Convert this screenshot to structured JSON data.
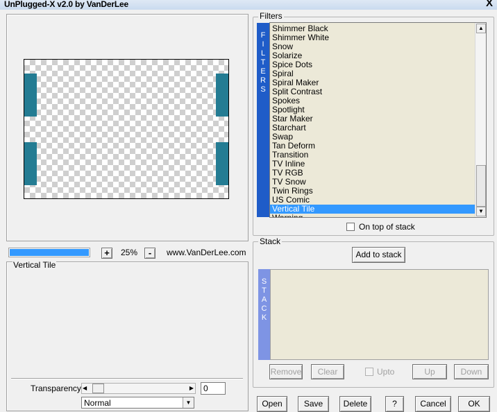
{
  "window": {
    "title": "UnPlugged-X v2.0 by VanDerLee",
    "close_glyph": "X"
  },
  "preview": {
    "zoom_minus": "-",
    "zoom_plus": "+",
    "zoom_level": "25%",
    "website": "www.VanDerLee.com",
    "progress_fraction": 1.0
  },
  "parameters": {
    "group_label": "Vertical Tile",
    "transparency_label": "Transparency",
    "transparency_value": "0",
    "blend_mode": "Normal"
  },
  "filters": {
    "group_label": "Filters",
    "side_label_letters": [
      "F",
      "I",
      "L",
      "T",
      "E",
      "R",
      "S"
    ],
    "items": [
      "Shimmer Black",
      "Shimmer White",
      "Snow",
      "Solarize",
      "Spice Dots",
      "Spiral",
      "Spiral Maker",
      "Split Contrast",
      "Spokes",
      "Spotlight",
      "Star Maker",
      "Starchart",
      "Swap",
      "Tan Deform",
      "Transition",
      "TV Inline",
      "TV RGB",
      "TV Snow",
      "Twin Rings",
      "US Comic",
      "Vertical Tile",
      "Warning"
    ],
    "selected": "Vertical Tile",
    "on_top_label": "On top of stack"
  },
  "stack": {
    "group_label": "Stack",
    "side_label_letters": [
      "S",
      "T",
      "A",
      "C",
      "K"
    ],
    "add_button": "Add to stack",
    "remove_button": "Remove",
    "clear_button": "Clear",
    "upto_label": "Upto",
    "up_button": "Up",
    "down_button": "Down"
  },
  "footer": {
    "open": "Open",
    "save": "Save",
    "delete": "Delete",
    "help": "?",
    "cancel": "Cancel",
    "ok": "OK"
  },
  "colors": {
    "accent": "#3399ff",
    "side_bar_dark": "#1f5cc8",
    "side_bar_light": "#7e94e4",
    "tile": "#247c93",
    "list_bg": "#ece9d8"
  }
}
